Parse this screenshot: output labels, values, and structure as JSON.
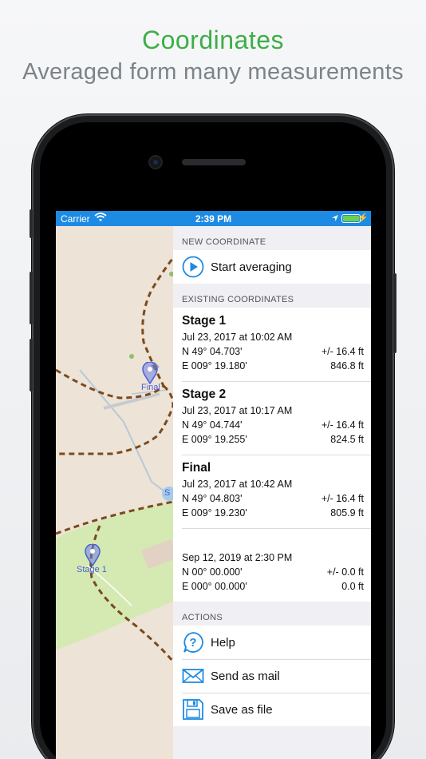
{
  "marketing": {
    "title": "Coordinates",
    "subtitle": "Averaged form many measurements"
  },
  "status_bar": {
    "carrier": "Carrier",
    "time": "2:39 PM"
  },
  "map": {
    "markers": [
      "Final",
      "Stage 1"
    ],
    "partial_label": "S",
    "path_color": "#7a4a1e",
    "marker_color": "#4a5fd6"
  },
  "new_coordinate": {
    "header": "NEW COORDINATE",
    "start_label": "Start averaging",
    "icon": "play-icon"
  },
  "existing": {
    "header": "EXISTING COORDINATES",
    "items": [
      {
        "name": "Stage 1",
        "date": "Jul 23, 2017 at 10:02 AM",
        "lat": "N 49° 04.703'",
        "lon": "E 009° 19.180'",
        "accuracy": "+/- 16.4 ft",
        "altitude": "846.8 ft"
      },
      {
        "name": "Stage 2",
        "date": "Jul 23, 2017 at 10:17 AM",
        "lat": "N 49° 04.744'",
        "lon": "E 009° 19.255'",
        "accuracy": "+/- 16.4 ft",
        "altitude": "824.5 ft"
      },
      {
        "name": "Final",
        "date": "Jul 23, 2017 at 10:42 AM",
        "lat": "N 49° 04.803'",
        "lon": "E 009° 19.230'",
        "accuracy": "+/- 16.4 ft",
        "altitude": "805.9 ft"
      },
      {
        "name": "",
        "date": "Sep 12, 2019 at 2:30 PM",
        "lat": "N 00° 00.000'",
        "lon": "E 000° 00.000'",
        "accuracy": "+/- 0.0 ft",
        "altitude": "0.0 ft"
      }
    ]
  },
  "actions": {
    "header": "ACTIONS",
    "items": [
      {
        "label": "Help",
        "icon": "help-icon"
      },
      {
        "label": "Send as mail",
        "icon": "mail-icon"
      },
      {
        "label": "Save as file",
        "icon": "floppy-disk-icon"
      }
    ]
  },
  "colors": {
    "brand_green": "#3dae48",
    "status_bar": "#1d8ae3",
    "icon_blue": "#1d8ae3"
  }
}
